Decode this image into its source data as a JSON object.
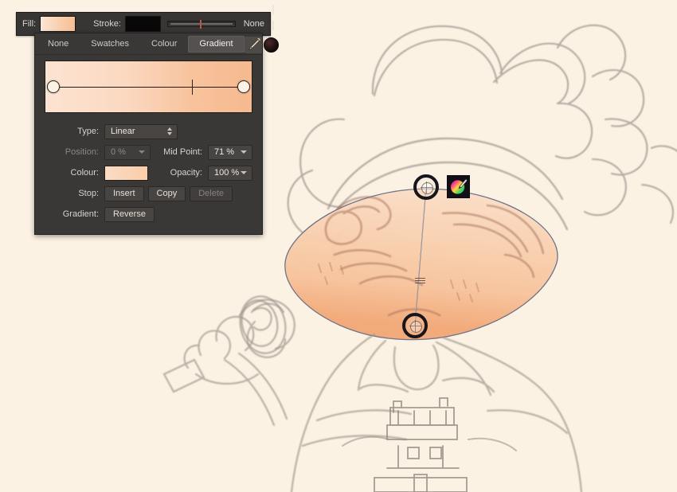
{
  "fill_bar": {
    "fill_label": "Fill:",
    "fill_color": "#f9cba6",
    "stroke_label": "Stroke:",
    "stroke_color": "#090808",
    "stroke_width_label": "None"
  },
  "panel": {
    "tabs": [
      {
        "label": "None",
        "active": false
      },
      {
        "label": "Swatches",
        "active": false
      },
      {
        "label": "Colour",
        "active": false
      },
      {
        "label": "Gradient",
        "active": true
      }
    ],
    "tools": {
      "eyedropper": "eyedropper-icon",
      "current_colour": "#2a1414"
    },
    "gradient_preview": {
      "start_color": "#fce4d2",
      "end_color": "#f6b98f",
      "mid_point_position": "71%"
    },
    "rows": {
      "type_label": "Type:",
      "type_value": "Linear",
      "position_label": "Position:",
      "position_value": "0 %",
      "mid_point_label": "Mid Point:",
      "mid_point_value": "71 %",
      "colour_label": "Colour:",
      "colour_value": "#f9cda8",
      "opacity_label": "Opacity:",
      "opacity_value": "100 %",
      "stop_label": "Stop:",
      "stop_insert": "Insert",
      "stop_copy": "Copy",
      "stop_delete": "Delete",
      "gradient_label": "Gradient:",
      "gradient_reverse": "Reverse"
    }
  },
  "canvas": {
    "background_color": "#fbf2e4",
    "shape_fill_start": "#fadfc7",
    "shape_fill_end": "#f4ac7c",
    "gradient_handles": {
      "start_name": "gradient-start-handle",
      "end_name": "gradient-end-handle",
      "midpoint_name": "gradient-midpoint-marker"
    },
    "colour_wheel_button": "colour-wheel-icon"
  }
}
